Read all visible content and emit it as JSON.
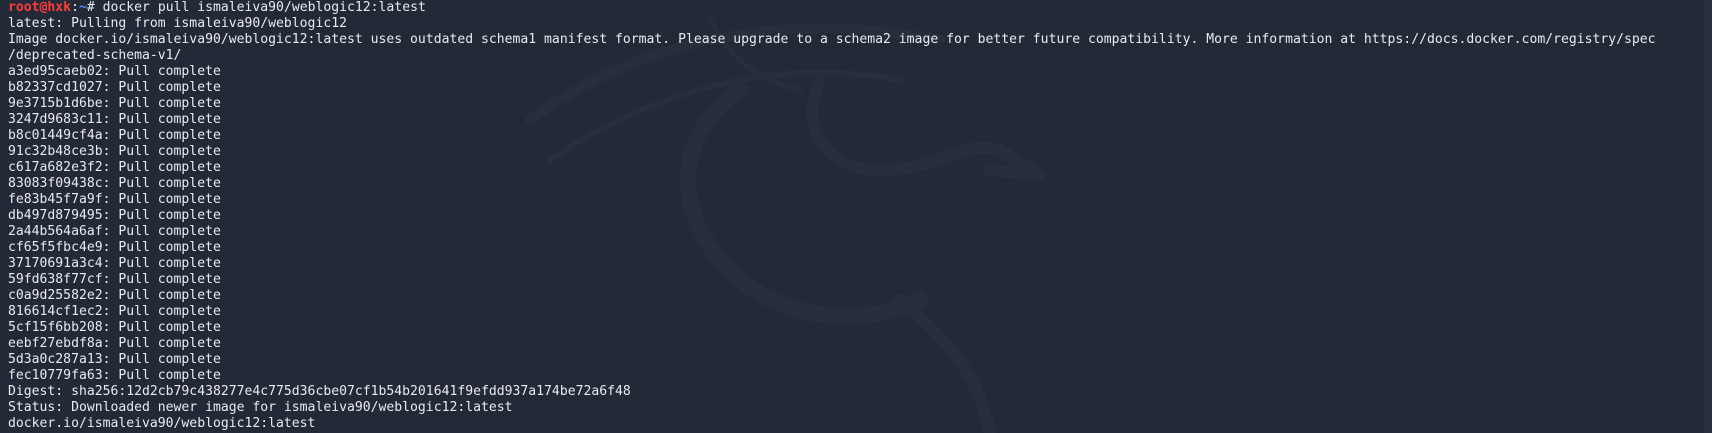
{
  "prompt": {
    "user_host": "root@hxk",
    "separator": ":",
    "path": "~",
    "symbol": "#",
    "command": " docker pull ismaleiva90/weblogic12:latest"
  },
  "output": [
    "latest: Pulling from ismaleiva90/weblogic12",
    "Image docker.io/ismaleiva90/weblogic12:latest uses outdated schema1 manifest format. Please upgrade to a schema2 image for better future compatibility. More information at https://docs.docker.com/registry/spec",
    "/deprecated-schema-v1/",
    "a3ed95caeb02: Pull complete",
    "b82337cd1027: Pull complete",
    "9e3715b1d6be: Pull complete",
    "3247d9683c11: Pull complete",
    "b8c01449cf4a: Pull complete",
    "91c32b48ce3b: Pull complete",
    "c617a682e3f2: Pull complete",
    "83083f09438c: Pull complete",
    "fe83b45f7a9f: Pull complete",
    "db497d879495: Pull complete",
    "2a44b564a6af: Pull complete",
    "cf65f5fbc4e9: Pull complete",
    "37170691a3c4: Pull complete",
    "59fd638f77cf: Pull complete",
    "c0a9d25582e2: Pull complete",
    "816614cf1ec2: Pull complete",
    "5cf15f6bb208: Pull complete",
    "eebf27ebdf8a: Pull complete",
    "5d3a0c287a13: Pull complete",
    "fec10779fa63: Pull complete",
    "Digest: sha256:12d2cb79c438277e4c775d36cbe07cf1b54b201641f9efdd937a174be72a6f48",
    "Status: Downloaded newer image for ismaleiva90/weblogic12:latest",
    "docker.io/ismaleiva90/weblogic12:latest"
  ],
  "colors": {
    "background": "#232936",
    "text": "#e8ebf0",
    "prompt_user": "#ff3b3b",
    "prompt_path": "#4f8cff"
  },
  "watermark_icon": "kali-dragon-icon"
}
